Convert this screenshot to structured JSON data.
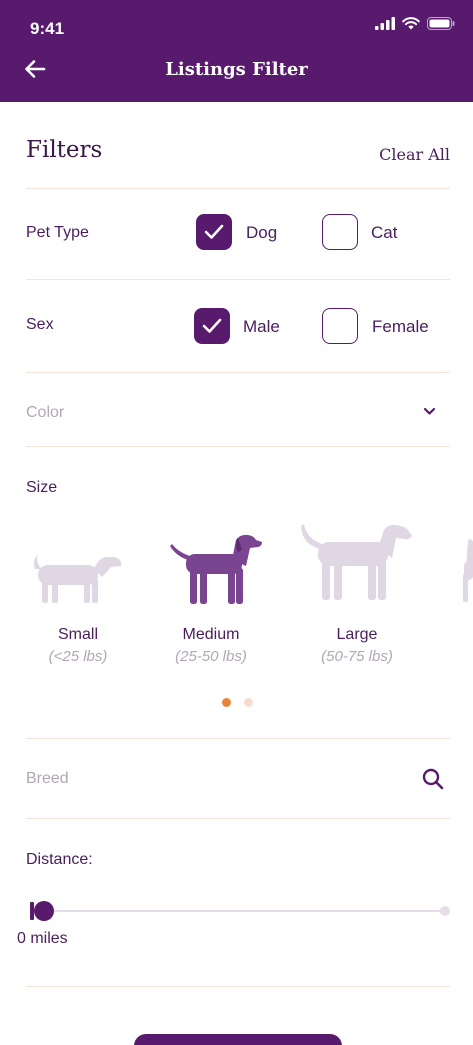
{
  "status": {
    "time": "9:41"
  },
  "header": {
    "title": "Listings Filter"
  },
  "filters": {
    "heading": "Filters",
    "clear_all": "Clear All",
    "pet_type": {
      "label": "Pet Type",
      "options": [
        {
          "label": "Dog",
          "checked": true
        },
        {
          "label": "Cat",
          "checked": false
        }
      ]
    },
    "sex": {
      "label": "Sex",
      "options": [
        {
          "label": "Male",
          "checked": true
        },
        {
          "label": "Female",
          "checked": false
        }
      ]
    },
    "color": {
      "label": "Color"
    },
    "size": {
      "label": "Size",
      "options": [
        {
          "name": "Small",
          "range": "(<25 lbs)",
          "selected": false
        },
        {
          "name": "Medium",
          "range": "(25-50 lbs)",
          "selected": true
        },
        {
          "name": "Large",
          "range": "(50-75 lbs)",
          "selected": false
        }
      ],
      "pages": 2,
      "current_page": 1
    },
    "breed": {
      "placeholder": "Breed"
    },
    "distance": {
      "label": "Distance:",
      "value_label": "0 miles",
      "value_fraction": 0
    }
  },
  "colors": {
    "primary": "#581a6c",
    "text": "#4a1e5d",
    "muted": "#b3a6b7",
    "divider": "#f6e3d9",
    "dog_unselected": "#e0d7e4",
    "dot_active": "#e8833a",
    "dot_inactive": "#f7dccd"
  }
}
